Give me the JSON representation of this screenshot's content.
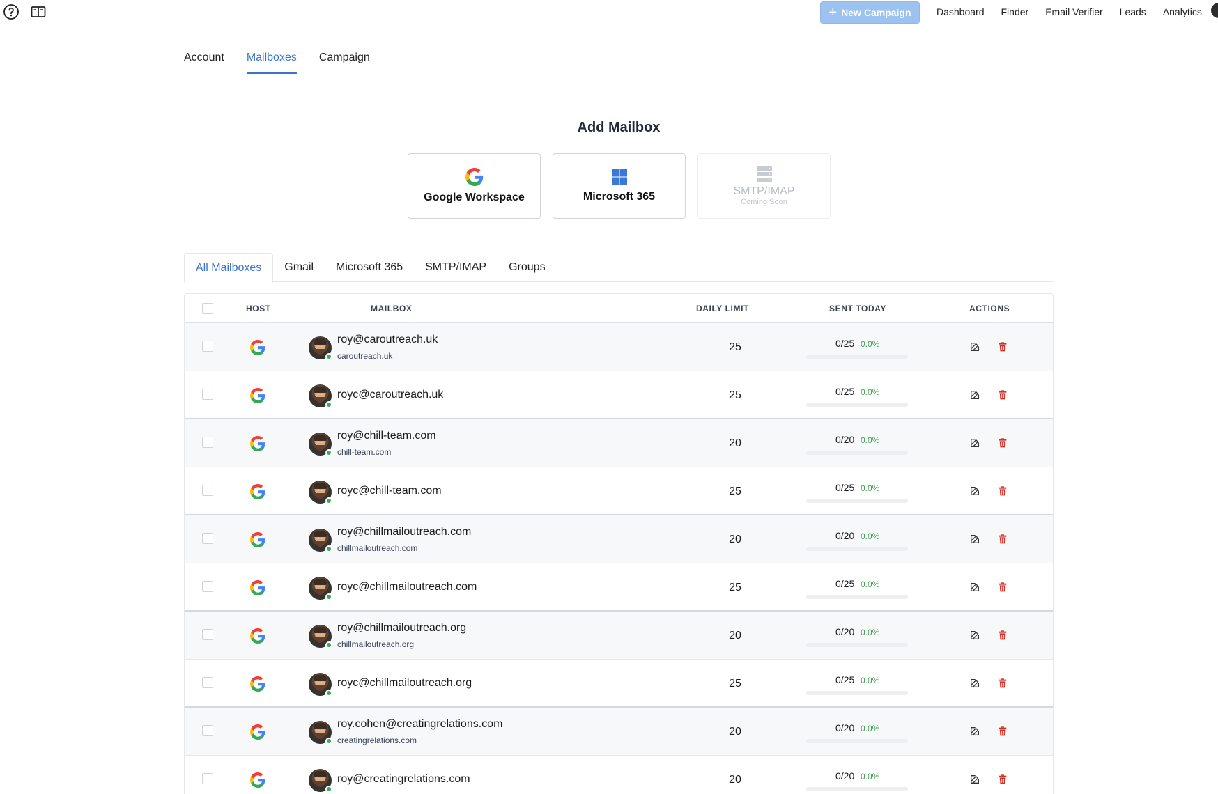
{
  "topbar": {
    "new_campaign_label": "New Campaign",
    "nav": [
      "Dashboard",
      "Finder",
      "Email Verifier",
      "Leads",
      "Analytics"
    ]
  },
  "settings_tabs": [
    "Account",
    "Mailboxes",
    "Campaign"
  ],
  "settings_active": "Mailboxes",
  "add_mailbox": {
    "title": "Add Mailbox",
    "providers": [
      {
        "label": "Google Workspace",
        "icon": "google-icon",
        "enabled": true
      },
      {
        "label": "Microsoft 365",
        "icon": "windows-icon",
        "enabled": true
      },
      {
        "label": "SMTP/IMAP",
        "sublabel": "Coming Soon",
        "icon": "server-icon",
        "enabled": false
      }
    ]
  },
  "filter_tabs": [
    "All Mailboxes",
    "Gmail",
    "Microsoft 365",
    "SMTP/IMAP",
    "Groups"
  ],
  "filter_active": "All Mailboxes",
  "table": {
    "headers": {
      "host": "HOST",
      "mailbox": "MAILBOX",
      "daily_limit": "DAILY LIMIT",
      "sent_today": "SENT TODAY",
      "actions": "ACTIONS"
    },
    "rows": [
      {
        "email": "roy@caroutreach.uk",
        "domain": "caroutreach.uk",
        "limit": "25",
        "sent": "0/25",
        "pct": "0.0%",
        "fill": 0
      },
      {
        "email": "royc@caroutreach.uk",
        "domain": "",
        "limit": "25",
        "sent": "0/25",
        "pct": "0.0%",
        "fill": 0
      },
      {
        "email": "roy@chill-team.com",
        "domain": "chill-team.com",
        "limit": "20",
        "sent": "0/20",
        "pct": "0.0%",
        "fill": 0
      },
      {
        "email": "royc@chill-team.com",
        "domain": "",
        "limit": "25",
        "sent": "0/25",
        "pct": "0.0%",
        "fill": 0
      },
      {
        "email": "roy@chillmailoutreach.com",
        "domain": "chillmailoutreach.com",
        "limit": "20",
        "sent": "0/20",
        "pct": "0.0%",
        "fill": 0
      },
      {
        "email": "royc@chillmailoutreach.com",
        "domain": "",
        "limit": "25",
        "sent": "0/25",
        "pct": "0.0%",
        "fill": 0
      },
      {
        "email": "roy@chillmailoutreach.org",
        "domain": "chillmailoutreach.org",
        "limit": "20",
        "sent": "0/20",
        "pct": "0.0%",
        "fill": 0
      },
      {
        "email": "royc@chillmailoutreach.org",
        "domain": "",
        "limit": "25",
        "sent": "0/25",
        "pct": "0.0%",
        "fill": 0
      },
      {
        "email": "roy.cohen@creatingrelations.com",
        "domain": "creatingrelations.com",
        "limit": "20",
        "sent": "0/20",
        "pct": "0.0%",
        "fill": 0
      },
      {
        "email": "roy@creatingrelations.com",
        "domain": "",
        "limit": "20",
        "sent": "0/20",
        "pct": "0.0%",
        "fill": 0
      }
    ]
  }
}
